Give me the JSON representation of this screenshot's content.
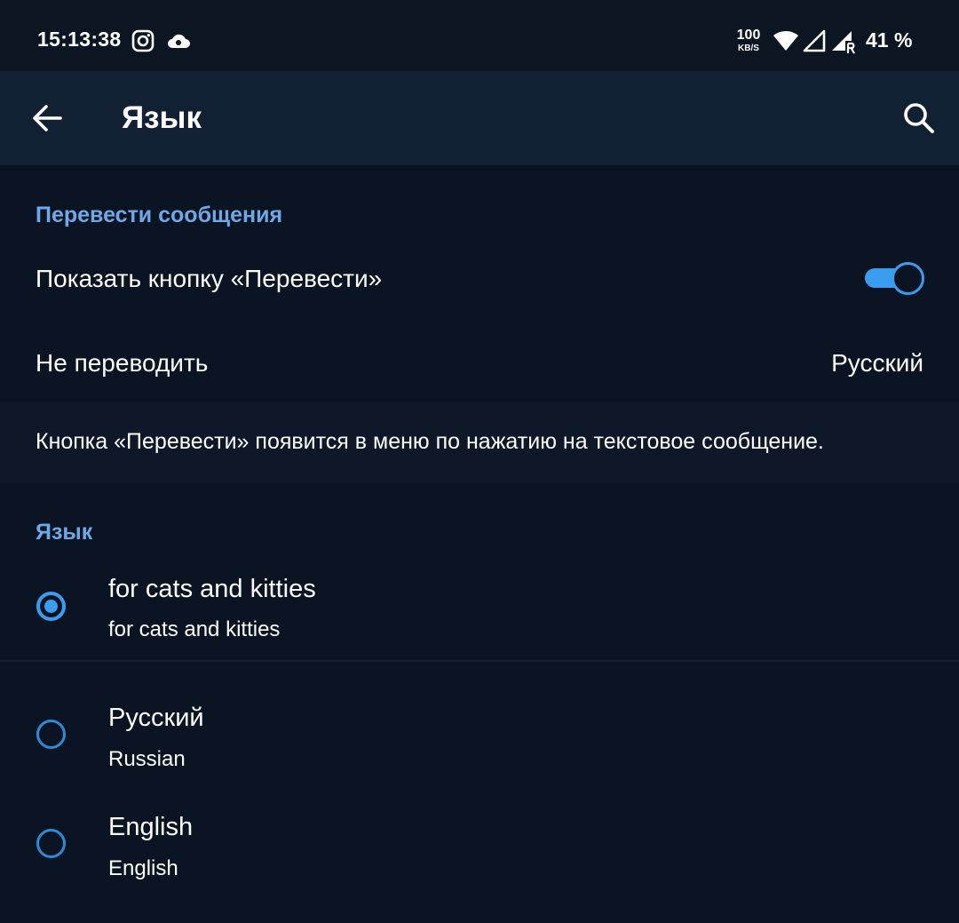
{
  "status_bar": {
    "time": "15:13:38",
    "net_speed_value": "100",
    "net_speed_unit": "KB/S",
    "battery": "41 %",
    "icons": [
      "instagram-icon",
      "cloud-icon",
      "wifi-icon",
      "signal-icon",
      "signal-roaming-icon"
    ]
  },
  "app_bar": {
    "title": "Язык",
    "back_icon": "arrow-back-icon",
    "search_icon": "search-icon"
  },
  "translate_section": {
    "header": "Перевести сообщения",
    "show_button_label": "Показать кнопку «Перевести»",
    "show_button_enabled": true,
    "do_not_translate_label": "Не переводить",
    "do_not_translate_value": "Русский",
    "info_text": "Кнопка «Перевести» появится в меню по нажатию на текстовое сообщение."
  },
  "language_section": {
    "header": "Язык",
    "items": [
      {
        "title": "for cats and kitties",
        "subtitle": "for cats and kitties",
        "selected": true
      },
      {
        "title": "Русский",
        "subtitle": "Russian",
        "selected": false
      },
      {
        "title": "English",
        "subtitle": "English",
        "selected": false
      }
    ]
  },
  "colors": {
    "accent": "#3b9df0",
    "section_header": "#6ea8e6",
    "background": "#0a1220",
    "app_bar": "#112033"
  }
}
